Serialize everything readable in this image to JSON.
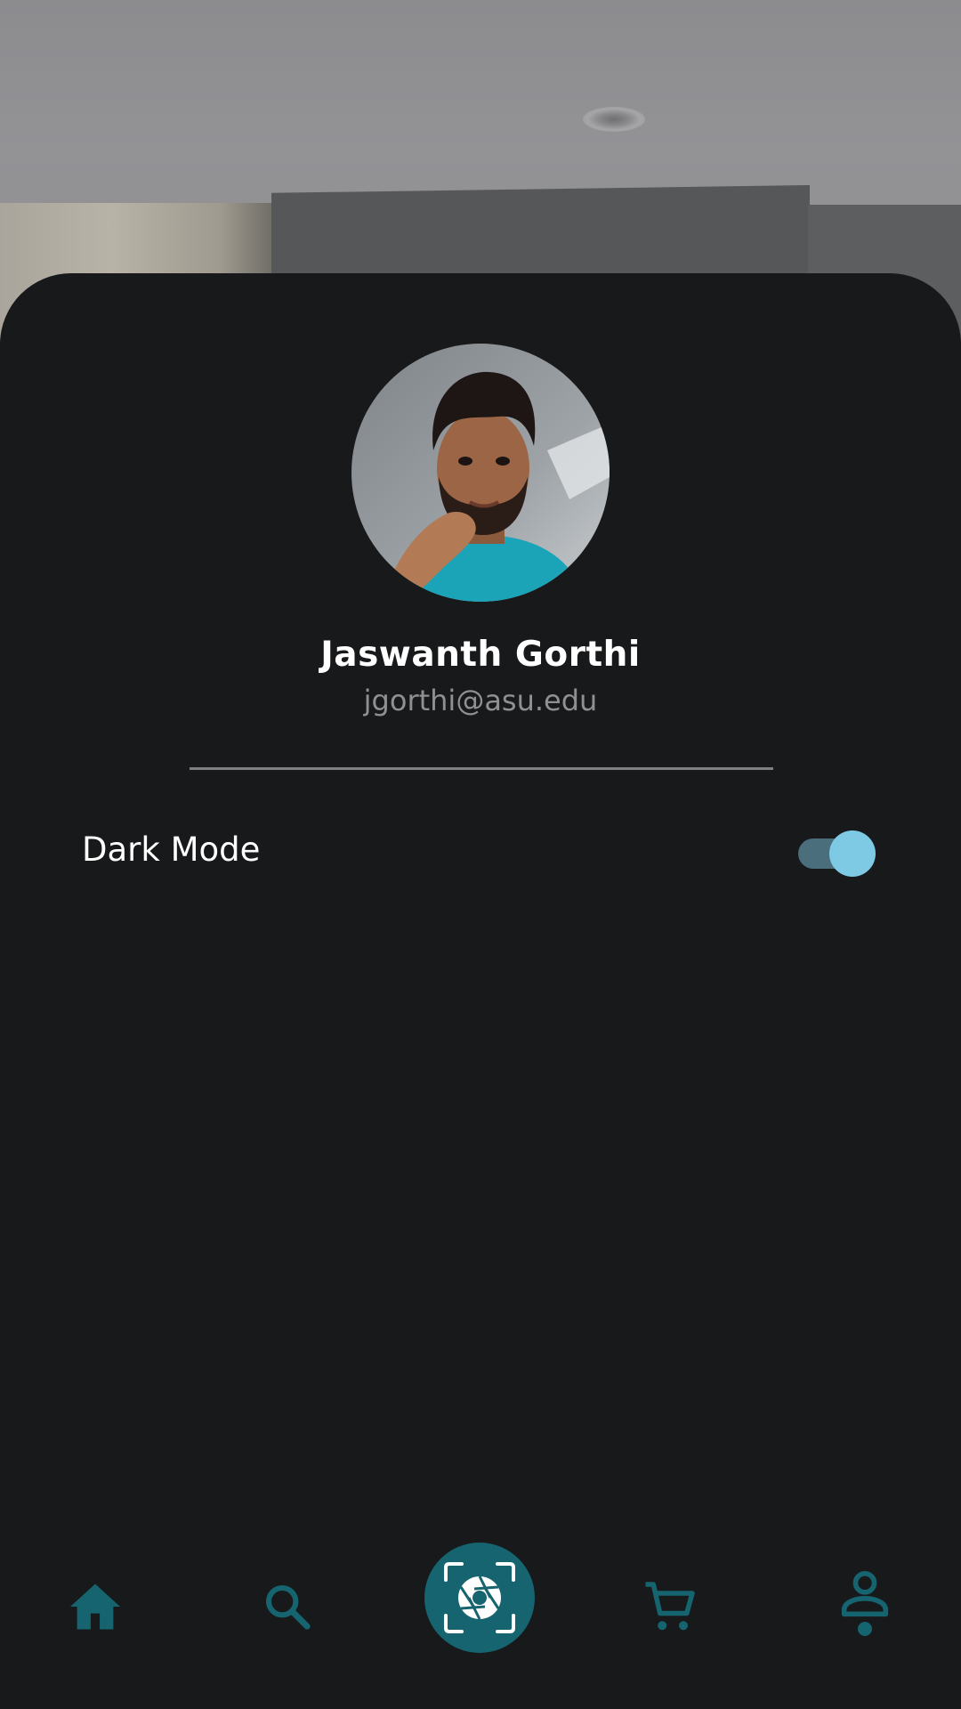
{
  "profile": {
    "name": "Jaswanth Gorthi",
    "email": "jgorthi@asu.edu",
    "avatar_icon": "profile-photo"
  },
  "settings": {
    "dark_mode_label": "Dark Mode",
    "dark_mode_enabled": true
  },
  "bottom_nav": {
    "items": [
      {
        "icon": "home-icon",
        "active": false
      },
      {
        "icon": "search-icon",
        "active": false
      },
      {
        "icon": "camera-scan-icon",
        "active": false
      },
      {
        "icon": "cart-icon",
        "active": false
      },
      {
        "icon": "person-icon",
        "active": true
      }
    ]
  },
  "colors": {
    "background": "#17191b",
    "accent": "#15646f",
    "toggle_thumb": "#7ec9e3",
    "toggle_track": "#4a6e7c",
    "text_primary": "#ffffff",
    "text_secondary": "#8e9092"
  }
}
